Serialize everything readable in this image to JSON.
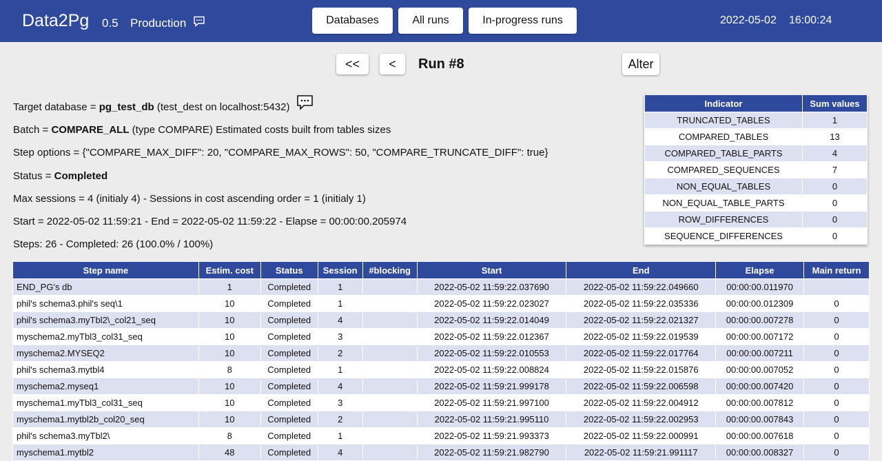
{
  "header": {
    "app_name": "Data2Pg",
    "version": "0.5",
    "environment": "Production",
    "nav": [
      "Databases",
      "All runs",
      "In-progress runs"
    ],
    "date": "2022-05-02",
    "time": "16:00:24"
  },
  "run": {
    "first_label": "<<",
    "prev_label": "<",
    "title": "Run #8",
    "alter_label": "Alter"
  },
  "info": {
    "target_prefix": "Target database = ",
    "target_db": "pg_test_db",
    "target_suffix": " (test_dest on localhost:5432)",
    "batch_prefix": "Batch = ",
    "batch_name": "COMPARE_ALL",
    "batch_suffix": " (type COMPARE)  Estimated costs built from tables sizes",
    "step_options": "Step options = {\"COMPARE_MAX_DIFF\": 20, \"COMPARE_MAX_ROWS\": 50, \"COMPARE_TRUNCATE_DIFF\": true}",
    "status_prefix": "Status = ",
    "status": "Completed",
    "sessions": "Max sessions = 4 (initialy 4) - Sessions in cost ascending order = 1 (initialy 1)",
    "timing": "Start = 2022-05-02 11:59:21 - End = 2022-05-02 11:59:22 - Elapse = 00:00:00.205974",
    "steps": "Steps: 26 - Completed: 26 (100.0% / 100%)"
  },
  "indicators": {
    "headers": [
      "Indicator",
      "Sum values"
    ],
    "rows": [
      [
        "TRUNCATED_TABLES",
        "1"
      ],
      [
        "COMPARED_TABLES",
        "13"
      ],
      [
        "COMPARED_TABLE_PARTS",
        "4"
      ],
      [
        "COMPARED_SEQUENCES",
        "7"
      ],
      [
        "NON_EQUAL_TABLES",
        "0"
      ],
      [
        "NON_EQUAL_TABLE_PARTS",
        "0"
      ],
      [
        "ROW_DIFFERENCES",
        "0"
      ],
      [
        "SEQUENCE_DIFFERENCES",
        "0"
      ]
    ]
  },
  "steps_table": {
    "headers": [
      "Step name",
      "Estim. cost",
      "Status",
      "Session",
      "#blocking",
      "Start",
      "End",
      "Elapse",
      "Main return"
    ],
    "rows": [
      [
        "END_PG's db",
        "1",
        "Completed",
        "1",
        "",
        "2022-05-02 11:59:22.037690",
        "2022-05-02 11:59:22.049660",
        "00:00:00.011970",
        ""
      ],
      [
        "phil's schema3.phil's seq\\1",
        "10",
        "Completed",
        "1",
        "",
        "2022-05-02 11:59:22.023027",
        "2022-05-02 11:59:22.035336",
        "00:00:00.012309",
        "0"
      ],
      [
        "phil's schema3.myTbl2\\_col21_seq",
        "10",
        "Completed",
        "4",
        "",
        "2022-05-02 11:59:22.014049",
        "2022-05-02 11:59:22.021327",
        "00:00:00.007278",
        "0"
      ],
      [
        "myschema2.myTbl3_col31_seq",
        "10",
        "Completed",
        "3",
        "",
        "2022-05-02 11:59:22.012367",
        "2022-05-02 11:59:22.019539",
        "00:00:00.007172",
        "0"
      ],
      [
        "myschema2.MYSEQ2",
        "10",
        "Completed",
        "2",
        "",
        "2022-05-02 11:59:22.010553",
        "2022-05-02 11:59:22.017764",
        "00:00:00.007211",
        "0"
      ],
      [
        "phil's schema3.mytbl4",
        "8",
        "Completed",
        "1",
        "",
        "2022-05-02 11:59:22.008824",
        "2022-05-02 11:59:22.015876",
        "00:00:00.007052",
        "0"
      ],
      [
        "myschema2.myseq1",
        "10",
        "Completed",
        "4",
        "",
        "2022-05-02 11:59:21.999178",
        "2022-05-02 11:59:22.006598",
        "00:00:00.007420",
        "0"
      ],
      [
        "myschema1.myTbl3_col31_seq",
        "10",
        "Completed",
        "3",
        "",
        "2022-05-02 11:59:21.997100",
        "2022-05-02 11:59:22.004912",
        "00:00:00.007812",
        "0"
      ],
      [
        "myschema1.mytbl2b_col20_seq",
        "10",
        "Completed",
        "2",
        "",
        "2022-05-02 11:59:21.995110",
        "2022-05-02 11:59:22.002953",
        "00:00:00.007843",
        "0"
      ],
      [
        "phil's schema3.myTbl2\\",
        "8",
        "Completed",
        "1",
        "",
        "2022-05-02 11:59:21.993373",
        "2022-05-02 11:59:22.000991",
        "00:00:00.007618",
        "0"
      ],
      [
        "myschema1.mytbl2",
        "48",
        "Completed",
        "4",
        "",
        "2022-05-02 11:59:21.982790",
        "2022-05-02 11:59:21.991117",
        "00:00:00.008327",
        "0"
      ]
    ]
  }
}
